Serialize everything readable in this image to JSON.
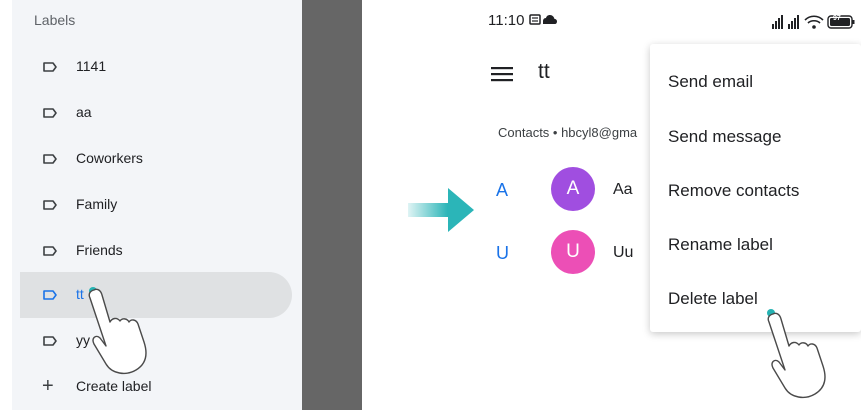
{
  "drawer": {
    "header": "Labels",
    "items": [
      {
        "label": "1141"
      },
      {
        "label": "aa"
      },
      {
        "label": "Coworkers"
      },
      {
        "label": "Family"
      },
      {
        "label": "Friends"
      },
      {
        "label": "tt"
      },
      {
        "label": "yy"
      }
    ],
    "active_index": 5,
    "create_label": "Create label"
  },
  "status_bar": {
    "time": "11:10",
    "battery": "97"
  },
  "screen": {
    "title": "tt",
    "account_line": "Contacts • hbcyl8@gma",
    "contacts": [
      {
        "section": "A",
        "initial": "A",
        "name": "Aa",
        "avatar_color": "#a04ee0"
      },
      {
        "section": "U",
        "initial": "U",
        "name": "Uu",
        "avatar_color": "#ec4fb6"
      }
    ]
  },
  "menu": {
    "items": [
      "Send email",
      "Send message",
      "Remove contacts",
      "Rename label",
      "Delete label"
    ]
  },
  "colors": {
    "accent": "#1a73e8",
    "arrow": "#2bb5b8",
    "tap_dot": "#26b3b3"
  }
}
